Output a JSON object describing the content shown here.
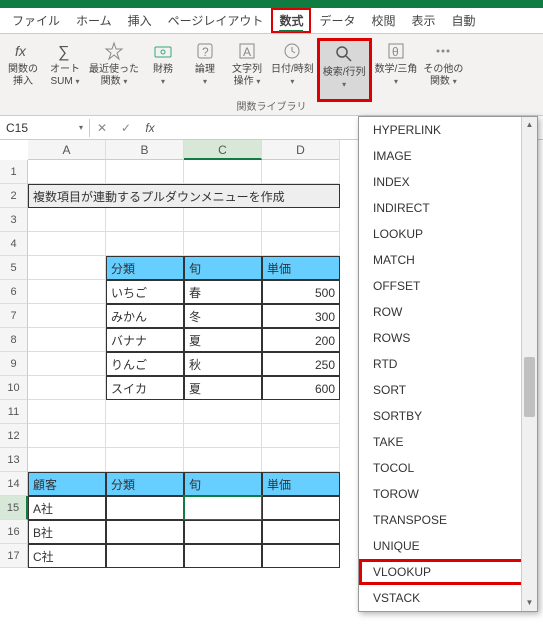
{
  "tabs": {
    "file": "ファイル",
    "home": "ホーム",
    "insert": "挿入",
    "pagelayout": "ページレイアウト",
    "formulas": "数式",
    "data": "データ",
    "review": "校閲",
    "view": "表示",
    "auto": "自動"
  },
  "ribbon": {
    "insert_fn_1": "関数の",
    "insert_fn_2": "挿入",
    "autosum_1": "オート",
    "autosum_2": "SUM",
    "recent_1": "最近使った",
    "recent_2": "関数",
    "financial": "財務",
    "logical": "論理",
    "text_1": "文字列",
    "text_2": "操作",
    "datetime": "日付/時刻",
    "lookup": "検索/行列",
    "math": "数学/三角",
    "other_1": "その他の",
    "other_2": "関数",
    "group": "関数ライブラリ"
  },
  "namebox": "C15",
  "cols": {
    "A": "A",
    "B": "B",
    "C": "C",
    "D": "D"
  },
  "rows": [
    "1",
    "2",
    "3",
    "4",
    "5",
    "6",
    "7",
    "8",
    "9",
    "10",
    "11",
    "12",
    "13",
    "14",
    "15",
    "16",
    "17"
  ],
  "cells": {
    "title": "複数項目が連動するプルダウンメニューを作成",
    "h_cat": "分類",
    "h_season": "旬",
    "h_price": "単価",
    "r6b": "いちご",
    "r6c": "春",
    "r6d": "500",
    "r7b": "みかん",
    "r7c": "冬",
    "r7d": "300",
    "r8b": "バナナ",
    "r8c": "夏",
    "r8d": "200",
    "r9b": "りんご",
    "r9c": "秋",
    "r9d": "250",
    "r10b": "スイカ",
    "r10c": "夏",
    "r10d": "600",
    "h14a": "顧客",
    "h14b": "分類",
    "h14c": "旬",
    "h14d": "単価",
    "r15a": "A社",
    "r16a": "B社",
    "r17a": "C社"
  },
  "dropdown": {
    "items": [
      "HYPERLINK",
      "IMAGE",
      "INDEX",
      "INDIRECT",
      "LOOKUP",
      "MATCH",
      "OFFSET",
      "ROW",
      "ROWS",
      "RTD",
      "SORT",
      "SORTBY",
      "TAKE",
      "TOCOL",
      "TOROW",
      "TRANSPOSE",
      "UNIQUE",
      "VLOOKUP",
      "VSTACK"
    ]
  }
}
